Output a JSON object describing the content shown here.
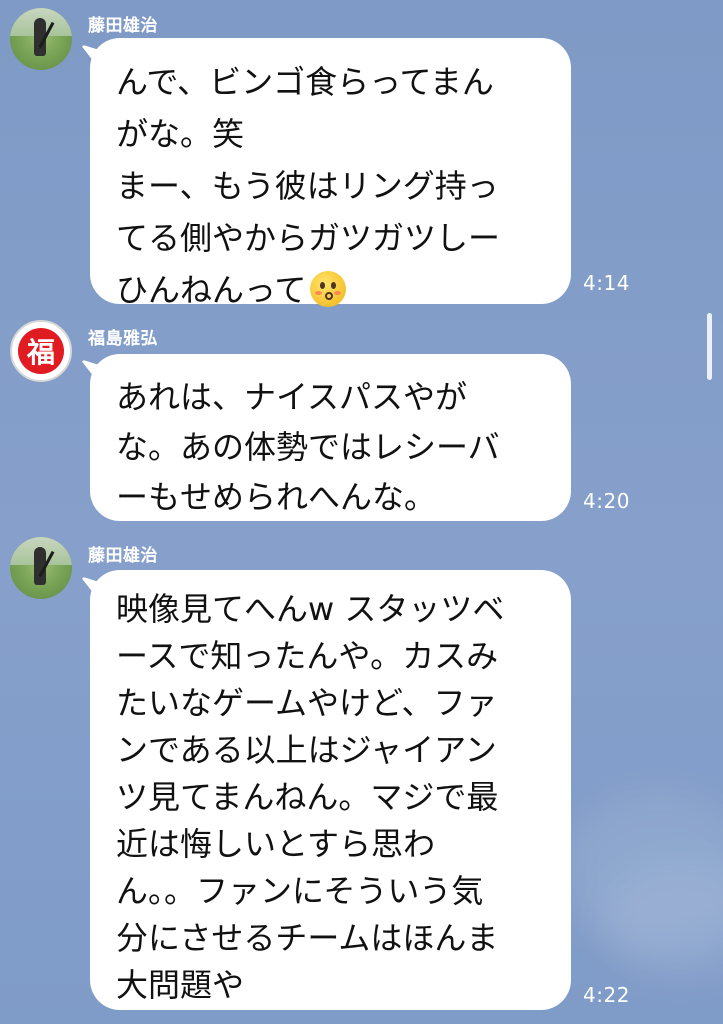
{
  "messages": [
    {
      "sender": "藤田雄治",
      "text": "んで、ビンゴ食らってまん\nがな。笑\nまー、もう彼はリング持っ\nてる側やからガツガツしー\nひんねんって",
      "emoji": "kissing-face-emoji",
      "time": "4:14",
      "avatar": "golfer-photo"
    },
    {
      "sender": "福島雅弘",
      "text": "あれは、ナイスパスやが\nな。あの体勢ではレシーバ\nーもせめられへんな。",
      "time": "4:20",
      "avatar": "fuku-seal",
      "avatar_label": "福"
    },
    {
      "sender": "藤田雄治",
      "text": "映像見てへんw スタッツベ\nースで知ったんや。カスみ\nたいなゲームやけど、ファ\nンである以上はジャイアン\nツ見てまんねん。マジで最\n近は悔しいとすら思わ\nん。。ファンにそういう気\n分にさせるチームはほんま\n大問題や",
      "time": "4:22",
      "avatar": "golfer-photo"
    }
  ],
  "colors": {
    "background": "#86a0cb",
    "bubble": "#ffffff",
    "accent_red": "#e11b22"
  }
}
